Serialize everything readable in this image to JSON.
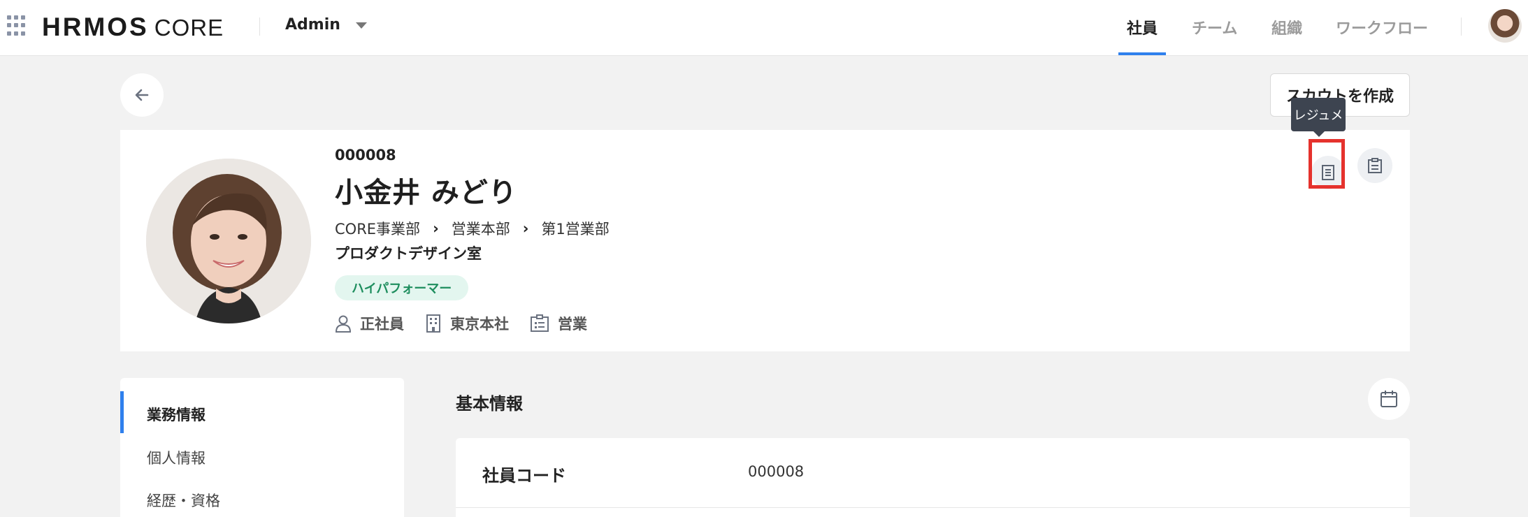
{
  "header": {
    "logo_main": "HRMOS",
    "logo_sub": "CORE",
    "account": "Admin",
    "nav": [
      "社員",
      "チーム",
      "組織",
      "ワークフロー"
    ],
    "active_nav": "社員"
  },
  "actions": {
    "create_button": "スカウトを作成",
    "tooltip": "レジュメ"
  },
  "employee": {
    "code": "000008",
    "name": "小金井 みどり",
    "org_path": [
      "CORE事業部",
      "営業本部",
      "第1営業部"
    ],
    "department": "プロダクトデザイン室",
    "tag": "ハイパフォーマー",
    "employment_type": "正社員",
    "office": "東京本社",
    "job_type": "営業"
  },
  "side_menu": {
    "items": [
      "業務情報",
      "個人情報",
      "経歴・資格"
    ],
    "active": "業務情報"
  },
  "main": {
    "section_title": "基本情報",
    "rows": [
      {
        "label": "社員コード",
        "value": "000008"
      }
    ]
  },
  "colors": {
    "accent": "#2f80ed",
    "highlight": "#e5322d",
    "tag_bg": "#e3f6ef",
    "tag_text": "#1e8e5e",
    "tooltip_bg": "#3d4450"
  }
}
